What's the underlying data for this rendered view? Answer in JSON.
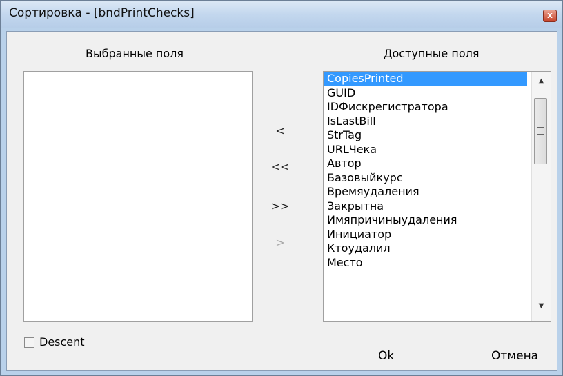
{
  "window": {
    "title": "Сортировка - [bndPrintChecks]",
    "close_symbol": "x"
  },
  "selected_panel": {
    "header": "Выбранные поля",
    "items": []
  },
  "available_panel": {
    "header": "Доступные поля",
    "items": [
      "CopiesPrinted",
      "GUID",
      "IDФискрегистратора",
      "IsLastBill",
      "StrTag",
      "URLЧека",
      "Автор",
      "Базовыйкурс",
      "Времяудаления",
      "Закрытна",
      "Имяпричиныудаления",
      "Инициатор",
      "Ктоудалил",
      "Место"
    ],
    "selected_index": 0,
    "scroll_up": "▲",
    "scroll_down": "▼"
  },
  "move_buttons": {
    "remove_one": "<",
    "remove_all": "<<",
    "add_all": ">>",
    "add_one": ">"
  },
  "descent": {
    "label": "Descent",
    "checked": false
  },
  "buttons": {
    "ok": "Ok",
    "cancel": "Отмена"
  }
}
